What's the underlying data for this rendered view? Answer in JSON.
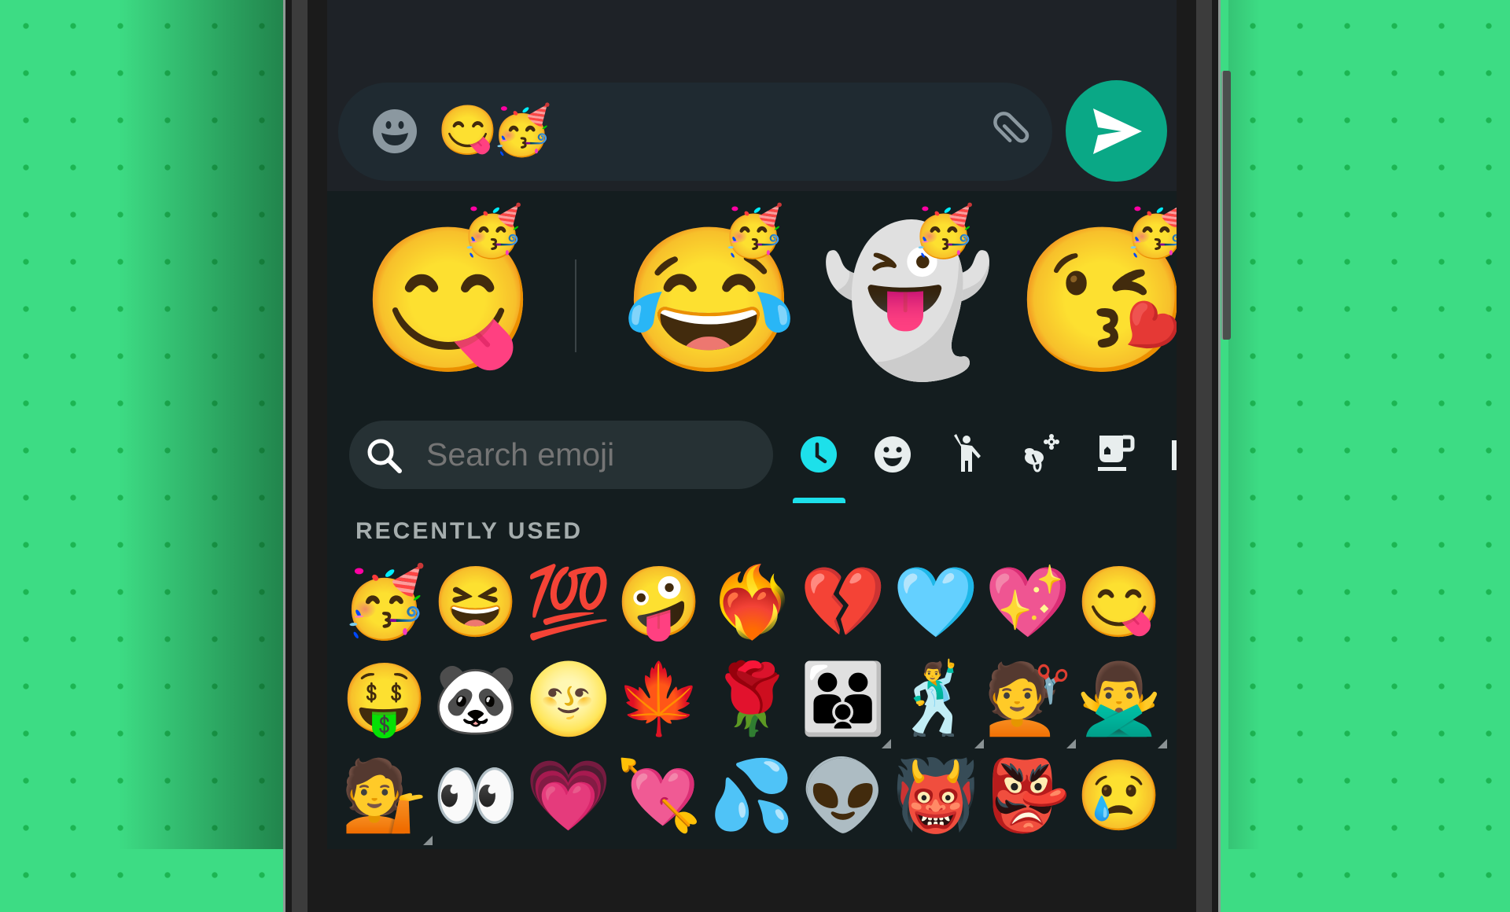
{
  "colors": {
    "background": "#3ddc84",
    "screen_bg": "#141d1f",
    "chat_bg": "#1e2227",
    "input_bg": "#1f2a31",
    "send_button": "#0aa886",
    "accent_active_tab": "#1de0ea",
    "icon_grey": "#8b98a0"
  },
  "composer": {
    "emoji_button_icon": "smiley-icon",
    "input_value": "😋🥳",
    "attach_icon": "paperclip-icon",
    "send_icon": "send-arrow-icon"
  },
  "emoji_kitchen": {
    "stickers": [
      {
        "name": "yum-party",
        "base": "😋",
        "topping": "🥳"
      },
      {
        "name": "joy-party",
        "base": "😂",
        "topping": "🥳"
      },
      {
        "name": "ghost-party",
        "base": "👻",
        "topping": "🥳"
      },
      {
        "name": "heart-party",
        "base": "😘",
        "topping": "🥳"
      }
    ]
  },
  "search": {
    "placeholder": "Search emoji",
    "icon": "search-icon"
  },
  "categories": [
    {
      "id": "recent",
      "icon": "clock-icon",
      "active": true
    },
    {
      "id": "smileys",
      "icon": "smiley-icon",
      "active": false
    },
    {
      "id": "people",
      "icon": "person-waving-icon",
      "active": false
    },
    {
      "id": "nature",
      "icon": "bee-flower-icon",
      "active": false
    },
    {
      "id": "food",
      "icon": "tea-cup-icon",
      "active": false
    },
    {
      "id": "travel",
      "icon": "travel-icon",
      "active": false
    }
  ],
  "section_title": "RECENTLY USED",
  "recent_emoji": [
    [
      "🥳",
      "😆",
      "💯",
      "🤪",
      "❤️‍🔥",
      "💔",
      "🩵",
      "💖",
      "😋"
    ],
    [
      "🤑",
      "🐼",
      "🌝",
      "🍁",
      "🌹",
      "🧑‍🧑‍🧒",
      "🕺",
      "💇",
      "🙅‍♂️"
    ],
    [
      "💁",
      "👀",
      "💗",
      "💘",
      "💦",
      "👽",
      "👹",
      "👺",
      "😢"
    ]
  ],
  "skin_tone_variants": [
    [
      false,
      false,
      false,
      false,
      false,
      false,
      false,
      false,
      false
    ],
    [
      false,
      false,
      false,
      false,
      false,
      true,
      true,
      true,
      true
    ],
    [
      true,
      false,
      false,
      false,
      false,
      false,
      false,
      false,
      false
    ]
  ]
}
